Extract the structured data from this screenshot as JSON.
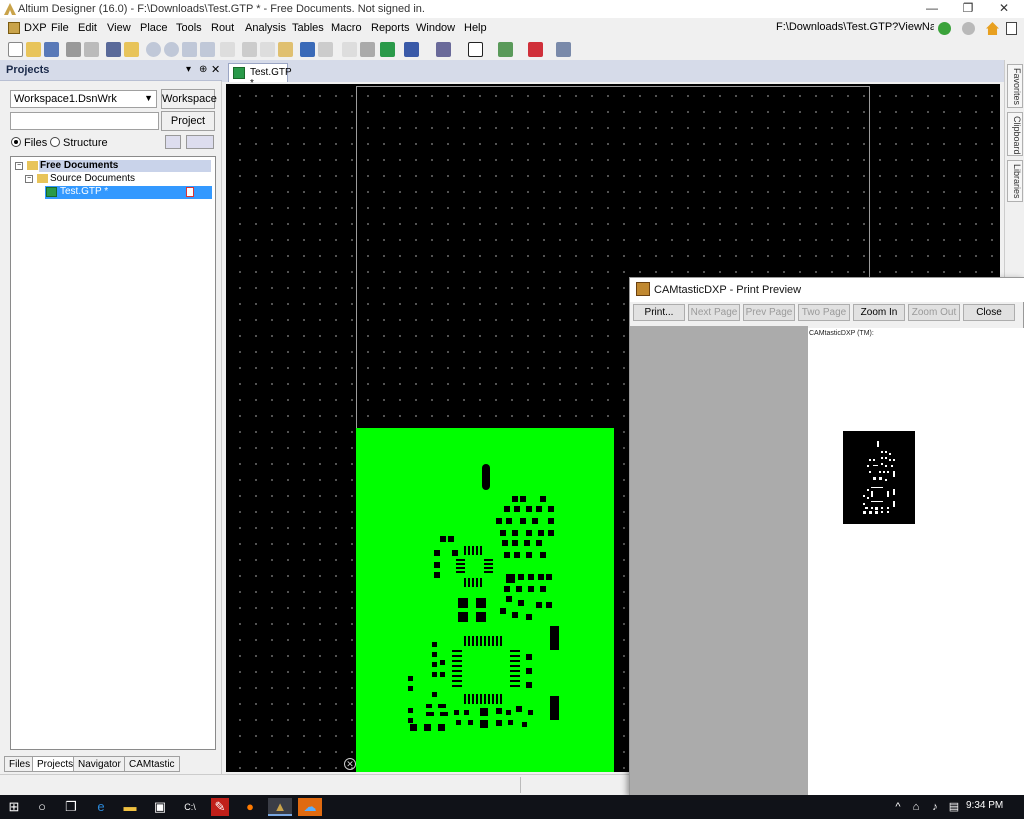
{
  "window": {
    "title": "Altium Designer (16.0) - F:\\Downloads\\Test.GTP * - Free Documents. Not signed in.",
    "controls": [
      "—",
      "❐",
      "✕"
    ]
  },
  "menu": {
    "items": [
      "DXP",
      "File",
      "Edit",
      "View",
      "Place",
      "Tools",
      "Rout",
      "Analysis",
      "Tables",
      "Macro",
      "Reports",
      "Window",
      "Help"
    ],
    "path": "F:\\Downloads\\Test.GTP?ViewNam•"
  },
  "projects_panel": {
    "title": "Projects",
    "header_buttons": [
      "▾",
      "⊕",
      "✕"
    ],
    "workspace_select": "Workspace1.DsnWrk",
    "workspace_button": "Workspace",
    "project_field": "",
    "project_button": "Project",
    "radio_files": "Files",
    "radio_structure": "Structure",
    "tree": {
      "root": "Free Documents",
      "folder": "Source Documents",
      "file": "Test.GTP *"
    },
    "bottom_tabs": [
      "Files",
      "Projects",
      "Navigator",
      "CAMtastic"
    ]
  },
  "document": {
    "tab_label": "Test.GTP *"
  },
  "right_tabs": [
    "Favorites",
    "Clipboard",
    "Libraries"
  ],
  "print_preview": {
    "title": "CAMtasticDXP - Print Preview",
    "buttons": {
      "print": "Print...",
      "next_page": "Next Page",
      "prev_page": "Prev Page",
      "two_page": "Two Page",
      "zoom_in": "Zoom In",
      "zoom_out": "Zoom Out",
      "close": "Close"
    },
    "page_caption": "CAMtasticDXP (TM):"
  },
  "taskbar": {
    "time": "9:34 PM"
  },
  "colors": {
    "board": "#00ff00",
    "canvas": "#000000",
    "selected": "#3399ff"
  }
}
